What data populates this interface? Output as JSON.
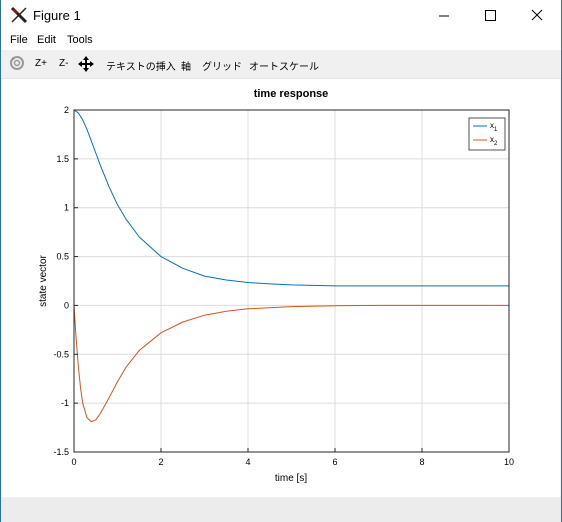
{
  "window": {
    "title": "Figure 1"
  },
  "menu": {
    "file": "File",
    "edit": "Edit",
    "tools": "Tools"
  },
  "toolbar": {
    "zoom_in": "Z+",
    "zoom_out": "Z-",
    "insert_text": "テキストの挿入",
    "axis": "軸",
    "grid": "グリッド",
    "autoscale": "オートスケール"
  },
  "chart_data": {
    "type": "line",
    "title": "time response",
    "xlabel": "time [s]",
    "ylabel": "state vector",
    "xlim": [
      0,
      10
    ],
    "ylim": [
      -1.5,
      2
    ],
    "xticks": [
      "0",
      "2",
      "4",
      "6",
      "8",
      "10"
    ],
    "yticks": [
      "-1.5",
      "-1",
      "-0.5",
      "0",
      "0.5",
      "1",
      "1.5",
      "2"
    ],
    "grid": true,
    "legend_position": "top-right",
    "series": [
      {
        "name": "x1",
        "color": "#0072bd",
        "x": [
          0,
          0.1,
          0.2,
          0.3,
          0.4,
          0.5,
          0.6,
          0.8,
          1,
          1.2,
          1.5,
          2,
          2.5,
          3,
          3.5,
          4,
          4.5,
          5,
          6,
          7,
          8,
          9,
          10
        ],
        "y": [
          2,
          1.97,
          1.9,
          1.8,
          1.68,
          1.56,
          1.44,
          1.22,
          1.03,
          0.88,
          0.7,
          0.5,
          0.38,
          0.3,
          0.26,
          0.235,
          0.22,
          0.21,
          0.2,
          0.2,
          0.2,
          0.2,
          0.2
        ]
      },
      {
        "name": "x2",
        "color": "#d95319",
        "x": [
          0,
          0.05,
          0.1,
          0.15,
          0.2,
          0.3,
          0.4,
          0.5,
          0.6,
          0.8,
          1,
          1.2,
          1.5,
          2,
          2.5,
          3,
          3.5,
          4,
          5,
          6,
          7,
          8,
          9,
          10
        ],
        "y": [
          0,
          -0.35,
          -0.62,
          -0.84,
          -1.0,
          -1.15,
          -1.19,
          -1.17,
          -1.11,
          -0.95,
          -0.78,
          -0.63,
          -0.46,
          -0.28,
          -0.17,
          -0.1,
          -0.06,
          -0.035,
          -0.012,
          -0.004,
          0,
          0,
          0,
          0
        ]
      }
    ]
  }
}
